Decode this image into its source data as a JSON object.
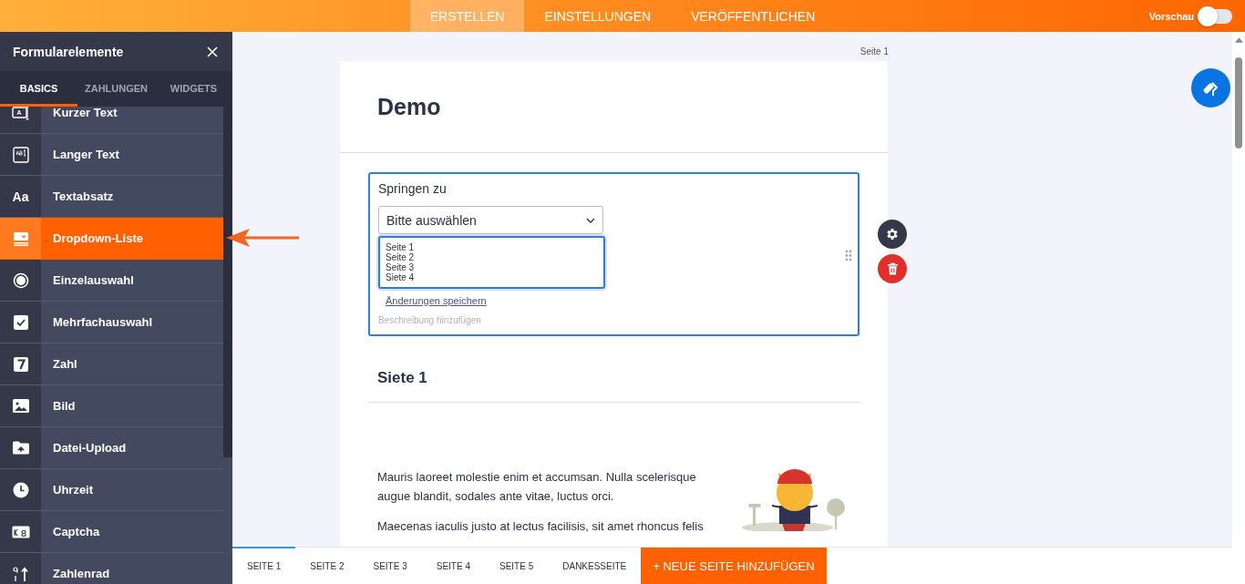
{
  "top_nav": {
    "tabs": [
      {
        "label": "ERSTELLEN",
        "selected": true
      },
      {
        "label": "EINSTELLUNGEN",
        "selected": false
      },
      {
        "label": "VERÖFFENTLICHEN",
        "selected": false
      }
    ],
    "preview": {
      "label": "Vorschau",
      "on": false
    }
  },
  "sidebar": {
    "title": "Formularelemente",
    "tabs": [
      {
        "label": "BASICS",
        "selected": true
      },
      {
        "label": "ZAHLUNGEN",
        "selected": false
      },
      {
        "label": "WIDGETS",
        "selected": false
      }
    ],
    "items": [
      {
        "label": "Kurzer Text",
        "kind": "shorttext",
        "selected": false
      },
      {
        "label": "Langer Text",
        "kind": "longtext",
        "selected": false
      },
      {
        "label": "Textabsatz",
        "kind": "paragraph",
        "icon_text": "Aa",
        "selected": false
      },
      {
        "label": "Dropdown-Liste",
        "kind": "dropdown",
        "selected": true
      },
      {
        "label": "Einzelauswahl",
        "kind": "radio",
        "selected": false
      },
      {
        "label": "Mehrfachauswahl",
        "kind": "checkbox",
        "selected": false
      },
      {
        "label": "Zahl",
        "kind": "number",
        "selected": false
      },
      {
        "label": "Bild",
        "kind": "image",
        "selected": false
      },
      {
        "label": "Datei-Upload",
        "kind": "upload",
        "selected": false
      },
      {
        "label": "Uhrzeit",
        "kind": "time",
        "selected": false
      },
      {
        "label": "Captcha",
        "kind": "captcha",
        "selected": false
      },
      {
        "label": "Zahlenrad",
        "kind": "spinner",
        "selected": false
      }
    ]
  },
  "form": {
    "page_label": "Seite 1",
    "title": "Demo",
    "field": {
      "label": "Springen zu",
      "select": {
        "placeholder": "Bitte auswählen"
      },
      "options": [
        "Seite 1",
        "Seite 2",
        "Seite 3",
        "Siete 4"
      ],
      "save_link": "Änderungen speichern",
      "description_placeholder": "Beschreibung hinzufügen"
    },
    "section_heading": "Siete 1",
    "paragraphs": [
      "Mauris laoreet molestie enim et accumsan. Nulla scelerisque augue blandit, sodales ante vitae, luctus orci.",
      "Maecenas iaculis justo at lectus facilisis, sit amet rhoncus felis"
    ]
  },
  "pages": [
    {
      "label": "SEITE 1",
      "selected": true
    },
    {
      "label": "SEITE 2",
      "selected": false
    },
    {
      "label": "SEITE 3",
      "selected": false
    },
    {
      "label": "SEITE 4",
      "selected": false
    },
    {
      "label": "SEITE 5",
      "selected": false
    },
    {
      "label": "DANKESSEITE",
      "selected": false
    }
  ],
  "add_page_button": "+ NEUE SEITE HINZUFÜGEN"
}
